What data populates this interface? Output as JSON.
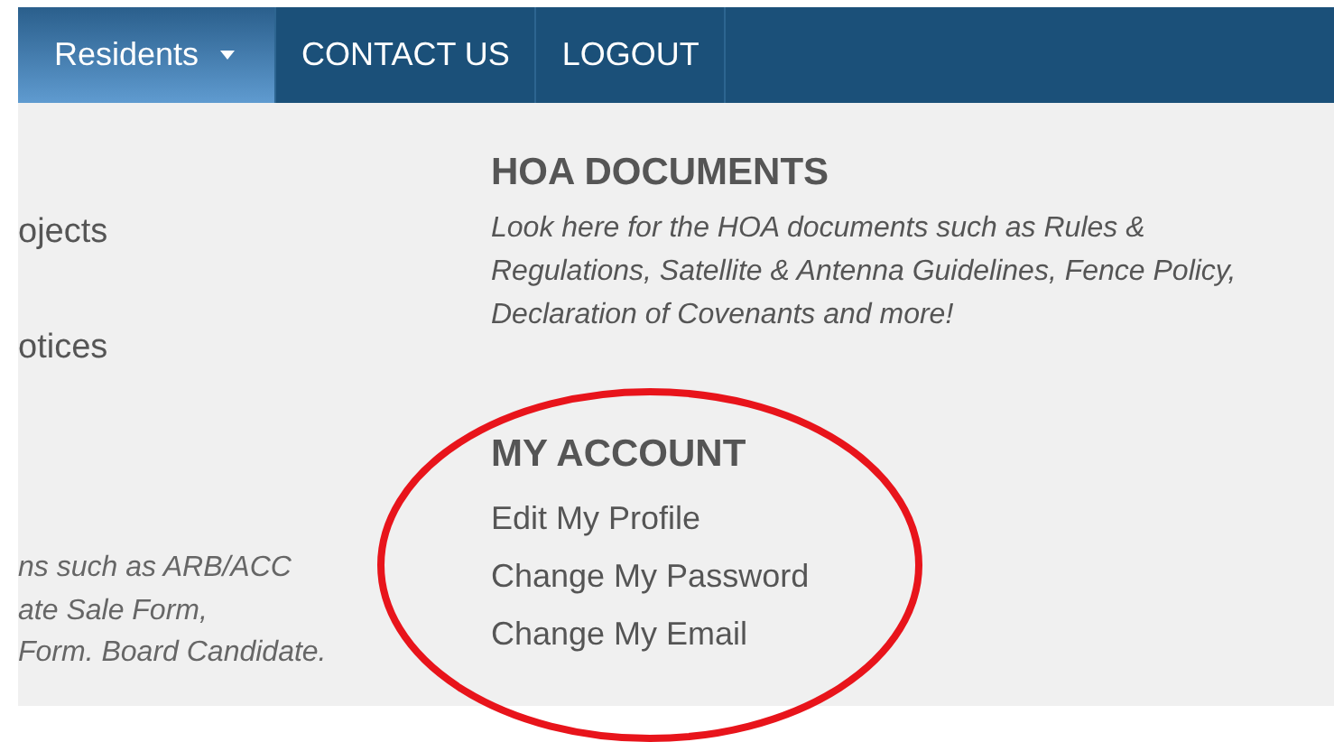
{
  "nav": {
    "items": [
      {
        "label": "Residents",
        "selected": true,
        "has_menu": true
      },
      {
        "label": "CONTACT US",
        "selected": false,
        "has_menu": false
      },
      {
        "label": "LOGOUT",
        "selected": false,
        "has_menu": false
      }
    ]
  },
  "left_column": {
    "links": [
      "ojects",
      "otices"
    ],
    "description_lines": [
      "ns such as ARB/ACC",
      "ate Sale Form,",
      "Form. Board Candidate."
    ]
  },
  "sections": [
    {
      "title": "HOA DOCUMENTS",
      "description": "Look here for the HOA documents such as Rules & Regulations, Satellite & Antenna Guidelines, Fence Policy, Declaration of Covenants and more!"
    },
    {
      "title": "MY ACCOUNT",
      "links": [
        "Edit My Profile",
        "Change My Password",
        "Change My Email"
      ]
    }
  ]
}
